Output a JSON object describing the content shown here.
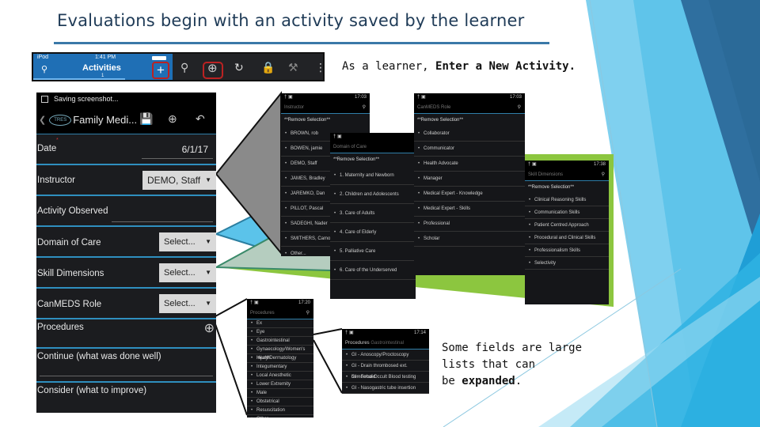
{
  "slide": {
    "title": "Evaluations begin with an activity saved by the learner",
    "caption_top_prefix": "As a learner, ",
    "caption_top_bold": "Enter a New Activity.",
    "caption_bottom_line1": "Some fields are large",
    "caption_bottom_line2": "lists that can",
    "caption_bottom_prefix": "be ",
    "caption_bottom_bold": "expanded",
    "caption_bottom_suffix": ".",
    "colors": {
      "title": "#1f3b57",
      "rule": "#3a78a8",
      "ios_blue": "#1f6fb5",
      "highlight_red": "#b22222",
      "divider_blue": "#2f8fbf",
      "callout_gray": "#7a7a7a",
      "callout_blue": "#5bc3ea",
      "callout_sage": "#b5cdbf",
      "callout_green": "#8cc63f"
    }
  },
  "toolbar_strip": {
    "ios": {
      "carrier": "iPod",
      "time": "1:41 PM",
      "title": "Activities",
      "count": "1",
      "search_icon": "search-icon",
      "add_icon": "plus-icon"
    },
    "android": {
      "icons": [
        "search-icon",
        "add-circle-icon",
        "refresh-icon",
        "lock-icon",
        "wrench-icon",
        "overflow-menu-icon"
      ]
    }
  },
  "main_form": {
    "status": "Saving screenshot...",
    "header_title": "Family Medi...",
    "logo_text": "TRES",
    "header_icons": [
      "save-icon",
      "add-circle-icon",
      "undo-icon"
    ],
    "fields": [
      {
        "label": "Date",
        "value": "6/1/17",
        "required": true
      },
      {
        "label": "Instructor",
        "value": "DEMO, Staff"
      },
      {
        "label": "Activity Observed",
        "value": ""
      },
      {
        "label": "Domain of Care",
        "value": "Select..."
      },
      {
        "label": "Skill Dimensions",
        "value": "Select..."
      },
      {
        "label": "CanMEDS Role",
        "value": "Select..."
      },
      {
        "label": "Procedures",
        "value": ""
      },
      {
        "label": "Continue (what was done well)",
        "value": ""
      },
      {
        "label": "Consider (what to improve)",
        "value": ""
      }
    ]
  },
  "instructor_list": {
    "time": "17:03",
    "header": "Instructor",
    "remove": "**Remove Selection**",
    "items": [
      "BROWN, rob",
      "BOWEN, jamie",
      "DEMO, Staff",
      "JAMES, Bradley",
      "JAREMKO, Dan",
      "PILLOT, Pascal",
      "SADEGHI, Nader",
      "SMITHERS, Camo",
      "Other..."
    ]
  },
  "domain_list": {
    "header": "Domain of Care",
    "remove": "**Remove Selection**",
    "items": [
      "1. Maternity and Newborn",
      "2. Children and Adolescents",
      "3. Care of Adults",
      "4. Care of Elderly",
      "5. Palliative Care",
      "6. Care of the Underserved"
    ]
  },
  "canmeds_list": {
    "time": "17:03",
    "header": "CanMEDS Role",
    "remove": "**Remove Selection**",
    "items": [
      "Collaborator",
      "Communicator",
      "Health Advocate",
      "Manager",
      "Medical Expert - Knowledge",
      "Medical Expert - Skills",
      "Professional",
      "Scholar"
    ]
  },
  "skill_list": {
    "time": "17:38",
    "header": "Skill Dimensions",
    "remove": "**Remove Selection**",
    "items": [
      "Clinical Reasoning Skills",
      "Communication Skills",
      "Patient Centred Approach",
      "Procedural and Clinical Skills",
      "Professionalism Skills",
      "Selectivity"
    ]
  },
  "procedures_list": {
    "time": "17:20",
    "header": "Procedures",
    "items": [
      "Ex",
      "Eye",
      "Gastrointestinal",
      "Gynaecology/Women's Health",
      "Injury/Dermatology",
      "Integumentary",
      "Local Anesthetic",
      "Lower Extremity",
      "Male",
      "Obstetrical",
      "Resuscitation",
      "Other"
    ]
  },
  "procedures_sub": {
    "time": "17:14",
    "header": "Procedures",
    "sub": "Gastrointestinal",
    "items": [
      "GI - Anoscopy/Proctoscopy",
      "GI - Drain thrombosed ext. hemorrhoid",
      "GI - Fecal Occult Blood testing",
      "GI - Nasogastric tube insertion"
    ]
  }
}
